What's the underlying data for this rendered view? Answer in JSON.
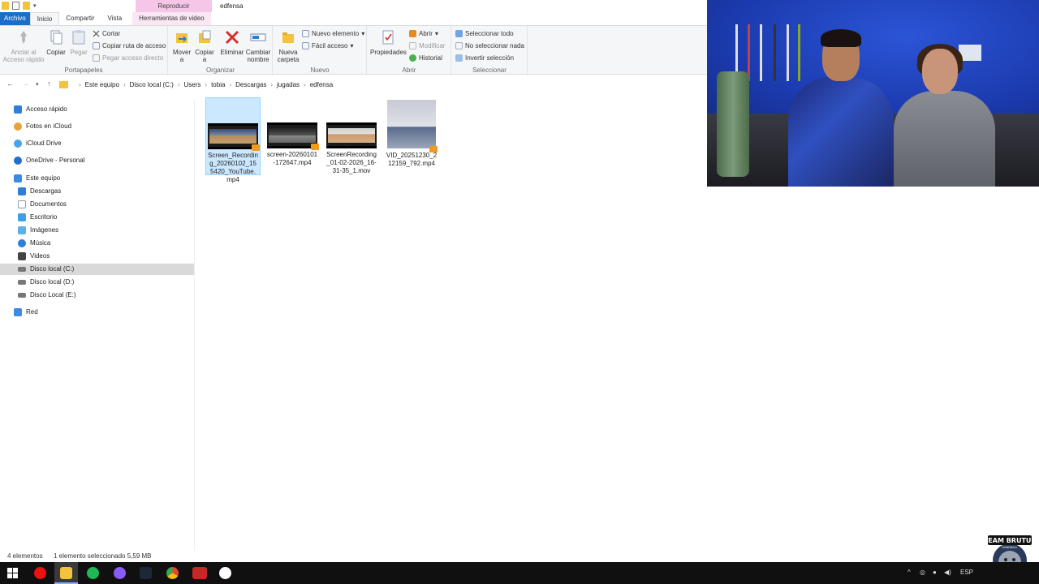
{
  "window": {
    "context_header": "Reproducir",
    "title": "edfensa",
    "tabs": [
      "Archivo",
      "Inicio",
      "Compartir",
      "Vista",
      "Herramientas de video"
    ]
  },
  "ribbon": {
    "portapapeles": {
      "label": "Portapapeles",
      "anclar": "Anclar al Acceso rápido",
      "copiar": "Copiar",
      "pegar": "Pegar",
      "cortar": "Cortar",
      "copiar_ruta": "Copiar ruta de acceso",
      "pegar_acceso": "Pegar acceso directo"
    },
    "organizar": {
      "label": "Organizar",
      "mover": "Mover a",
      "copiar_a": "Copiar a",
      "eliminar": "Eliminar",
      "cambiar_nombre": "Cambiar nombre"
    },
    "nuevo": {
      "label": "Nuevo",
      "nueva_carpeta": "Nueva carpeta",
      "nuevo_elemento": "Nuevo elemento",
      "facil_acceso": "Fácil acceso"
    },
    "abrir": {
      "label": "Abrir",
      "propiedades": "Propiedades",
      "abrir": "Abrir",
      "modificar": "Modificar",
      "historial": "Historial"
    },
    "seleccionar": {
      "label": "Seleccionar",
      "todo": "Seleccionar todo",
      "nada": "No seleccionar nada",
      "invertir": "Invertir selección"
    }
  },
  "address": {
    "crumbs": [
      "Este equipo",
      "Disco local (C:)",
      "Users",
      "tobia",
      "Descargas",
      "jugadas",
      "edfensa"
    ]
  },
  "sidebar": {
    "items": [
      "Acceso rápido",
      "Fotos en iCloud",
      "iCloud Drive",
      "OneDrive - Personal",
      "Este equipo",
      "Descargas",
      "Documentos",
      "Escritorio",
      "Imágenes",
      "Música",
      "Videos",
      "Disco local (C:)",
      "Disco local (D:)",
      "Disco Local (E:)",
      "Red"
    ]
  },
  "files": [
    {
      "name": "Screen_Recording_20260102_155420_YouTube.mp4"
    },
    {
      "name": "screen-20260101-172647.mp4"
    },
    {
      "name": "ScreenRecording_01-02-2026_16-31-35_1.mov"
    },
    {
      "name": "VID_20251230_212159_792.mp4"
    }
  ],
  "status": {
    "count": "4 elementos",
    "selection": "1 elemento seleccionado  5,59 MB"
  },
  "logo": {
    "text": "TEAM BRUTUS",
    "sub": "HANDBALL"
  },
  "tray": {
    "lang": "ESP"
  }
}
